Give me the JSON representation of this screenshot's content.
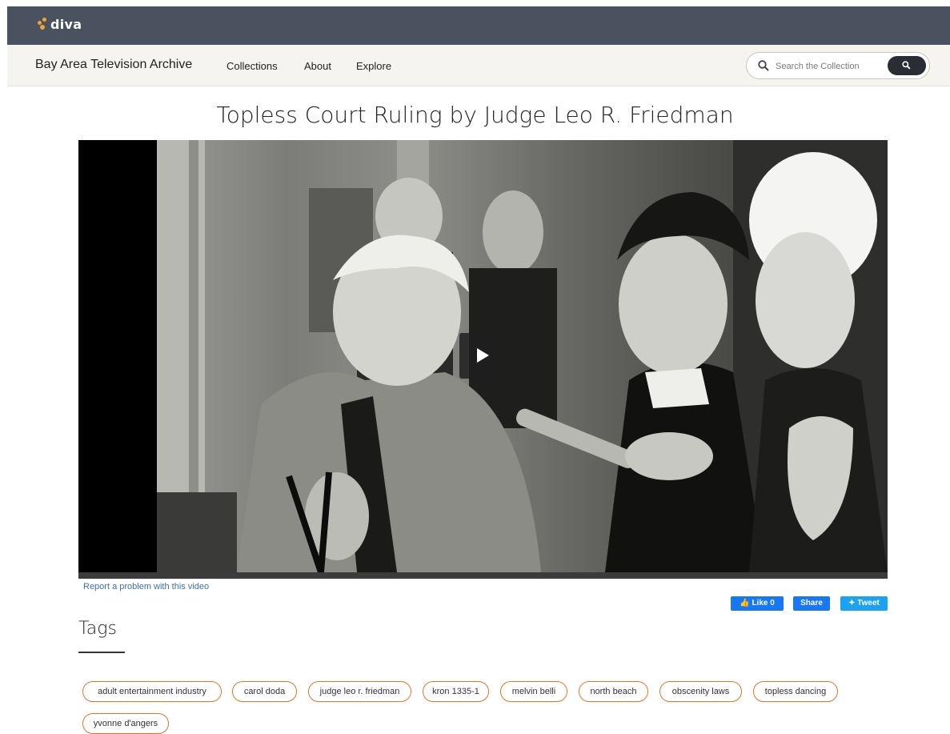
{
  "brand": {
    "logo_text": "diva",
    "accent_color": "#f2a33a"
  },
  "nav": {
    "site_title": "Bay Area Television Archive",
    "links": [
      "Collections",
      "About",
      "Explore"
    ]
  },
  "search": {
    "placeholder": "Search the Collection",
    "button_icon": "search-icon"
  },
  "page": {
    "title": "Topless Court Ruling by Judge Leo R. Friedman"
  },
  "video": {
    "play_icon": "play-icon",
    "report_link": "Report a problem with this video"
  },
  "social": {
    "like": "Like 0",
    "share": "Share",
    "tweet": "Tweet"
  },
  "tags": {
    "heading": "Tags",
    "items": [
      "adult entertainment industry",
      "carol doda",
      "judge leo r. friedman",
      "kron 1335-1",
      "melvin belli",
      "north beach",
      "obscenity laws",
      "topless dancing",
      "yvonne d'angers"
    ],
    "border_color": "#e0742c"
  }
}
